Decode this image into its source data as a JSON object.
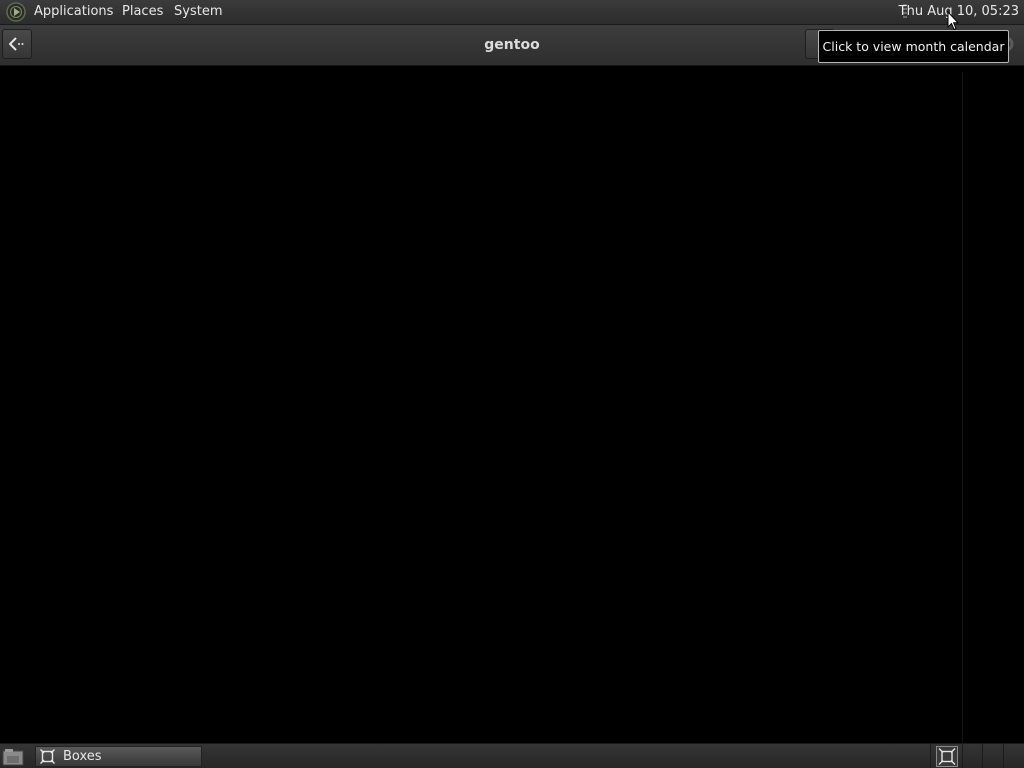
{
  "top_panel": {
    "menus": {
      "applications": "Applications",
      "places": "Places",
      "system": "System"
    },
    "clock": "Thu Aug 10, 05:23"
  },
  "window": {
    "title": "gentoo"
  },
  "tooltip": {
    "text": "Click to view month calendar"
  },
  "taskbar": {
    "tasks": [
      {
        "label": "Boxes",
        "icon": "boxes-icon",
        "active": true
      }
    ]
  },
  "icons": {
    "logo": "gnome-foot-logo",
    "back": "back-arrow-icon",
    "show_desktop": "show-desktop-icon",
    "tray": "boxes-tray-icon"
  },
  "colors": {
    "panel": "#2f2f2f",
    "content_background": "#000000",
    "text": "#e8e8e8"
  }
}
